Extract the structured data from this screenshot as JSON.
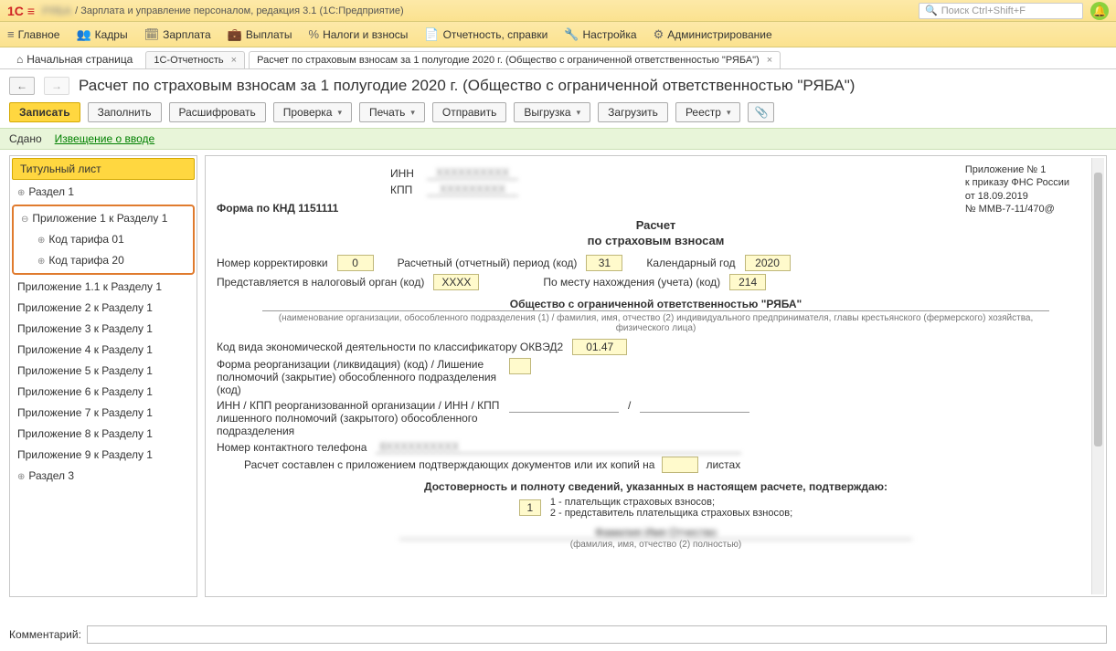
{
  "title_bar": {
    "logo": "1C",
    "blur_text": "РЯБА",
    "app_title": "/ Зарплата и управление персоналом, редакция 3.1  (1С:Предприятие)",
    "search_placeholder": "Поиск Ctrl+Shift+F"
  },
  "main_menu": [
    {
      "icon": "≡",
      "label": "Главное"
    },
    {
      "icon": "👥",
      "label": "Кадры"
    },
    {
      "icon": "🗓",
      "label": "Зарплата"
    },
    {
      "icon": "💼",
      "label": "Выплаты"
    },
    {
      "icon": "%",
      "label": "Налоги и взносы"
    },
    {
      "icon": "📄",
      "label": "Отчетность, справки"
    },
    {
      "icon": "🔧",
      "label": "Настройка"
    },
    {
      "icon": "⚙",
      "label": "Администрирование"
    }
  ],
  "tabs": {
    "home": "Начальная страница",
    "items": [
      {
        "label": "1С-Отчетность"
      },
      {
        "label": "Расчет по страховым взносам за 1 полугодие 2020 г. (Общество с ограниченной ответственностью  \"РЯБА\")",
        "active": true
      }
    ]
  },
  "page_title": "Расчет по страховым взносам за 1 полугодие 2020 г. (Общество с ограниченной ответственностью  \"РЯБА\")",
  "toolbar": {
    "write": "Записать",
    "fill": "Заполнить",
    "decode": "Расшифровать",
    "check": "Проверка",
    "print": "Печать",
    "send": "Отправить",
    "export": "Выгрузка",
    "load": "Загрузить",
    "registry": "Реестр"
  },
  "status": {
    "label": "Сдано",
    "link": "Извещение о вводе"
  },
  "sidebar": {
    "title_sheet": "Титульный лист",
    "section1": "Раздел 1",
    "group_label": "Приложение 1 к Разделу 1",
    "tariff01": "Код тарифа 01",
    "tariff20": "Код тарифа 20",
    "app11": "Приложение 1.1 к Разделу 1",
    "app2": "Приложение 2 к Разделу 1",
    "app3": "Приложение 3 к Разделу 1",
    "app4": "Приложение 4 к Разделу 1",
    "app5": "Приложение 5 к Разделу 1",
    "app6": "Приложение 6 к Разделу 1",
    "app7": "Приложение 7 к Разделу 1",
    "app8": "Приложение 8 к Разделу 1",
    "app9": "Приложение 9 к Разделу 1",
    "section3": "Раздел 3"
  },
  "form": {
    "inn_label": "ИНН",
    "kpp_label": "КПП",
    "appendix_l1": "Приложение № 1",
    "appendix_l2": "к приказу ФНС России",
    "appendix_l3": "от 18.09.2019",
    "appendix_l4": "№ ММВ-7-11/470@",
    "knd": "Форма по КНД 1151111",
    "title1": "Расчет",
    "title2": "по страховым взносам",
    "corr_label": "Номер корректировки",
    "corr_val": "0",
    "period_label": "Расчетный (отчетный) период (код)",
    "period_val": "31",
    "year_label": "Календарный год",
    "year_val": "2020",
    "tax_org_label": "Представляется в налоговый орган (код)",
    "tax_org_val": "",
    "place_label": "По месту нахождения (учета) (код)",
    "place_val": "214",
    "org_name": "Общество с ограниченной ответственностью \"РЯБА\"",
    "org_hint": "(наименование организации, обособленного подразделения (1) / фамилия, имя, отчество (2) индивидуального предпринимателя, главы крестьянского (фермерского) хозяйства, физического лица)",
    "okved_label": "Код вида экономической деятельности по классификатору ОКВЭД2",
    "okved_val": "01.47",
    "reorg_label": "Форма реорганизации (ликвидация) (код) / Лишение полномочий (закрытие) обособленного подразделения (код)",
    "inn_kpp_label": "ИНН / КПП реорганизованной организации / ИНН / КПП лишенного полномочий (закрытого) обособленного подразделения",
    "slash": "/",
    "phone_label": "Номер контактного телефона",
    "docs_label_1": "Расчет составлен с приложением подтверждающих документов или их копий на",
    "docs_label_2": "листах",
    "confirm_title": "Достоверность и полноту сведений, указанных в настоящем расчете, подтверждаю:",
    "confirm_val": "1",
    "confirm_opt1": "1 - плательщик страховых взносов;",
    "confirm_opt2": "2 - представитель плательщика страховых взносов;",
    "fio_hint": "(фамилия, имя, отчество (2) полностью)"
  },
  "comment_label": "Комментарий:"
}
